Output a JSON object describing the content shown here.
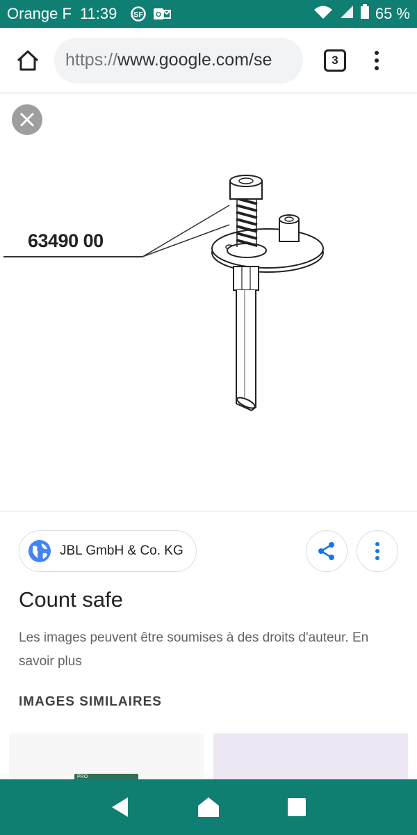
{
  "status_bar": {
    "carrier": "Orange F",
    "time": "11:39",
    "battery": "65 %",
    "icons": [
      "sfr-icon",
      "outlook-icon",
      "wifi-icon",
      "signal-icon",
      "battery-icon"
    ]
  },
  "browser": {
    "url_scheme": "https://",
    "url_host": "www.google.com/se",
    "tab_count": "3"
  },
  "viewer": {
    "part_number": "63490 00"
  },
  "info": {
    "source": "JBL GmbH & Co. KG",
    "title": "Count safe",
    "copyright": "Les images peuvent être soumises à des droits d'auteur. En savoir plus",
    "similar_heading": "IMAGES SIMILAIRES",
    "thumb_badge": "PRO"
  },
  "colors": {
    "system_bar": "#0f7f73",
    "link_blue": "#4285f4"
  }
}
